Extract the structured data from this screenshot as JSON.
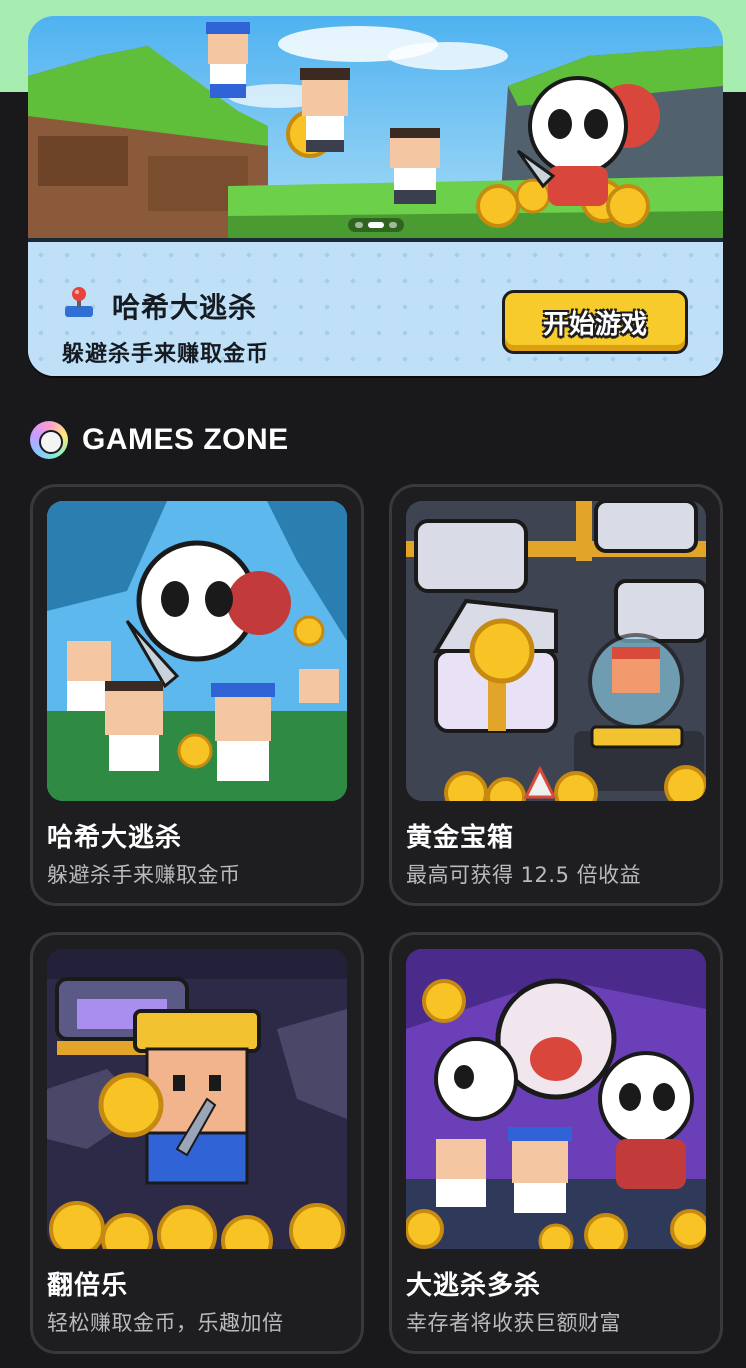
{
  "banner": {
    "title": "哈希大逃杀",
    "subtitle": "躲避杀手来赚取金币",
    "start_button": "开始游戏",
    "carousel_total": 3,
    "carousel_active": 1,
    "icon": "joystick-icon"
  },
  "zone": {
    "title": "GAMES ZONE",
    "icon": "rainbow-ring-icon"
  },
  "games": [
    {
      "title": "哈希大逃杀",
      "subtitle": "躲避杀手来赚取金币"
    },
    {
      "title": "黄金宝箱",
      "subtitle": "最高可获得 12.5 倍收益"
    },
    {
      "title": "翻倍乐",
      "subtitle": "轻松赚取金币，乐趣加倍"
    },
    {
      "title": "大逃杀多杀",
      "subtitle": "幸存者将收获巨额财富"
    }
  ],
  "colors": {
    "background": "#19191b",
    "top_strip": "#a7ecb0",
    "button_yellow": "#f6cb2b",
    "card_border": "#39393d"
  }
}
